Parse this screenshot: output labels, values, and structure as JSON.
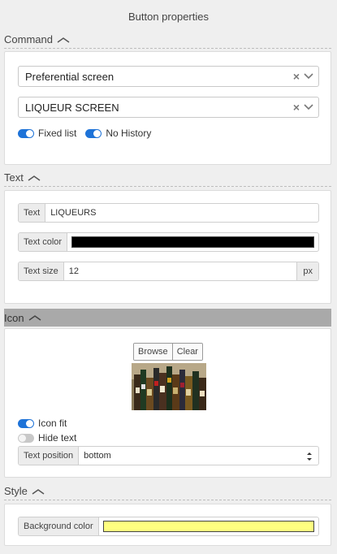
{
  "title": "Button properties",
  "sections": {
    "command": {
      "header": "Command",
      "select1": "Preferential screen",
      "select2": "LIQUEUR SCREEN",
      "toggles": [
        {
          "label": "Fixed list",
          "on": true
        },
        {
          "label": "No History",
          "on": true
        }
      ]
    },
    "text": {
      "header": "Text",
      "text_label": "Text",
      "text_value": "LIQUEURS",
      "color_label": "Text color",
      "color_value": "#000000",
      "size_label": "Text size",
      "size_value": "12",
      "size_unit": "px"
    },
    "icon": {
      "header": "Icon",
      "browse_label": "Browse",
      "clear_label": "Clear",
      "icon_fit_label": "Icon fit",
      "icon_fit_on": true,
      "hide_text_label": "Hide text",
      "hide_text_on": false,
      "position_label": "Text position",
      "position_value": "bottom"
    },
    "style": {
      "header": "Style",
      "bg_label": "Background color",
      "bg_value": "#ffff80"
    }
  }
}
